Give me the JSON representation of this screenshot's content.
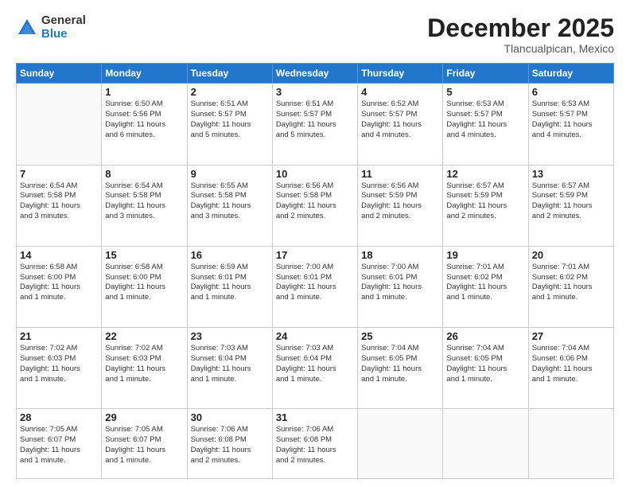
{
  "logo": {
    "general": "General",
    "blue": "Blue"
  },
  "title": "December 2025",
  "location": "Tlancualpican, Mexico",
  "days_of_week": [
    "Sunday",
    "Monday",
    "Tuesday",
    "Wednesday",
    "Thursday",
    "Friday",
    "Saturday"
  ],
  "weeks": [
    [
      {
        "num": "",
        "info": ""
      },
      {
        "num": "1",
        "info": "Sunrise: 6:50 AM\nSunset: 5:56 PM\nDaylight: 11 hours\nand 6 minutes."
      },
      {
        "num": "2",
        "info": "Sunrise: 6:51 AM\nSunset: 5:57 PM\nDaylight: 11 hours\nand 5 minutes."
      },
      {
        "num": "3",
        "info": "Sunrise: 6:51 AM\nSunset: 5:57 PM\nDaylight: 11 hours\nand 5 minutes."
      },
      {
        "num": "4",
        "info": "Sunrise: 6:52 AM\nSunset: 5:57 PM\nDaylight: 11 hours\nand 4 minutes."
      },
      {
        "num": "5",
        "info": "Sunrise: 6:53 AM\nSunset: 5:57 PM\nDaylight: 11 hours\nand 4 minutes."
      },
      {
        "num": "6",
        "info": "Sunrise: 6:53 AM\nSunset: 5:57 PM\nDaylight: 11 hours\nand 4 minutes."
      }
    ],
    [
      {
        "num": "7",
        "info": "Sunrise: 6:54 AM\nSunset: 5:58 PM\nDaylight: 11 hours\nand 3 minutes."
      },
      {
        "num": "8",
        "info": "Sunrise: 6:54 AM\nSunset: 5:58 PM\nDaylight: 11 hours\nand 3 minutes."
      },
      {
        "num": "9",
        "info": "Sunrise: 6:55 AM\nSunset: 5:58 PM\nDaylight: 11 hours\nand 3 minutes."
      },
      {
        "num": "10",
        "info": "Sunrise: 6:56 AM\nSunset: 5:58 PM\nDaylight: 11 hours\nand 2 minutes."
      },
      {
        "num": "11",
        "info": "Sunrise: 6:56 AM\nSunset: 5:59 PM\nDaylight: 11 hours\nand 2 minutes."
      },
      {
        "num": "12",
        "info": "Sunrise: 6:57 AM\nSunset: 5:59 PM\nDaylight: 11 hours\nand 2 minutes."
      },
      {
        "num": "13",
        "info": "Sunrise: 6:57 AM\nSunset: 5:59 PM\nDaylight: 11 hours\nand 2 minutes."
      }
    ],
    [
      {
        "num": "14",
        "info": "Sunrise: 6:58 AM\nSunset: 6:00 PM\nDaylight: 11 hours\nand 1 minute."
      },
      {
        "num": "15",
        "info": "Sunrise: 6:58 AM\nSunset: 6:00 PM\nDaylight: 11 hours\nand 1 minute."
      },
      {
        "num": "16",
        "info": "Sunrise: 6:59 AM\nSunset: 6:01 PM\nDaylight: 11 hours\nand 1 minute."
      },
      {
        "num": "17",
        "info": "Sunrise: 7:00 AM\nSunset: 6:01 PM\nDaylight: 11 hours\nand 1 minute."
      },
      {
        "num": "18",
        "info": "Sunrise: 7:00 AM\nSunset: 6:01 PM\nDaylight: 11 hours\nand 1 minute."
      },
      {
        "num": "19",
        "info": "Sunrise: 7:01 AM\nSunset: 6:02 PM\nDaylight: 11 hours\nand 1 minute."
      },
      {
        "num": "20",
        "info": "Sunrise: 7:01 AM\nSunset: 6:02 PM\nDaylight: 11 hours\nand 1 minute."
      }
    ],
    [
      {
        "num": "21",
        "info": "Sunrise: 7:02 AM\nSunset: 6:03 PM\nDaylight: 11 hours\nand 1 minute."
      },
      {
        "num": "22",
        "info": "Sunrise: 7:02 AM\nSunset: 6:03 PM\nDaylight: 11 hours\nand 1 minute."
      },
      {
        "num": "23",
        "info": "Sunrise: 7:03 AM\nSunset: 6:04 PM\nDaylight: 11 hours\nand 1 minute."
      },
      {
        "num": "24",
        "info": "Sunrise: 7:03 AM\nSunset: 6:04 PM\nDaylight: 11 hours\nand 1 minute."
      },
      {
        "num": "25",
        "info": "Sunrise: 7:04 AM\nSunset: 6:05 PM\nDaylight: 11 hours\nand 1 minute."
      },
      {
        "num": "26",
        "info": "Sunrise: 7:04 AM\nSunset: 6:05 PM\nDaylight: 11 hours\nand 1 minute."
      },
      {
        "num": "27",
        "info": "Sunrise: 7:04 AM\nSunset: 6:06 PM\nDaylight: 11 hours\nand 1 minute."
      }
    ],
    [
      {
        "num": "28",
        "info": "Sunrise: 7:05 AM\nSunset: 6:07 PM\nDaylight: 11 hours\nand 1 minute."
      },
      {
        "num": "29",
        "info": "Sunrise: 7:05 AM\nSunset: 6:07 PM\nDaylight: 11 hours\nand 1 minute."
      },
      {
        "num": "30",
        "info": "Sunrise: 7:06 AM\nSunset: 6:08 PM\nDaylight: 11 hours\nand 2 minutes."
      },
      {
        "num": "31",
        "info": "Sunrise: 7:06 AM\nSunset: 6:08 PM\nDaylight: 11 hours\nand 2 minutes."
      },
      {
        "num": "",
        "info": ""
      },
      {
        "num": "",
        "info": ""
      },
      {
        "num": "",
        "info": ""
      }
    ]
  ]
}
